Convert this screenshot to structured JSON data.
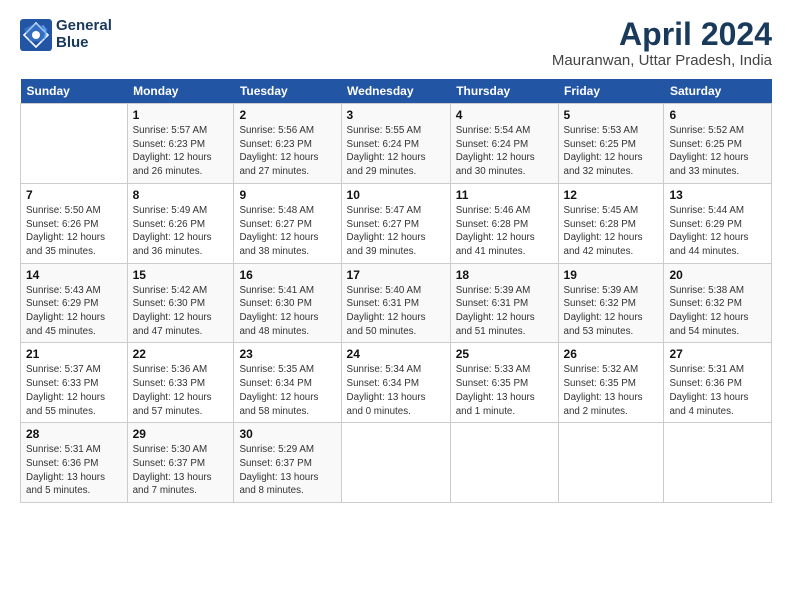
{
  "header": {
    "logo_line1": "General",
    "logo_line2": "Blue",
    "title": "April 2024",
    "subtitle": "Mauranwan, Uttar Pradesh, India"
  },
  "days_of_week": [
    "Sunday",
    "Monday",
    "Tuesday",
    "Wednesday",
    "Thursday",
    "Friday",
    "Saturday"
  ],
  "weeks": [
    [
      {
        "num": "",
        "info": ""
      },
      {
        "num": "1",
        "info": "Sunrise: 5:57 AM\nSunset: 6:23 PM\nDaylight: 12 hours\nand 26 minutes."
      },
      {
        "num": "2",
        "info": "Sunrise: 5:56 AM\nSunset: 6:23 PM\nDaylight: 12 hours\nand 27 minutes."
      },
      {
        "num": "3",
        "info": "Sunrise: 5:55 AM\nSunset: 6:24 PM\nDaylight: 12 hours\nand 29 minutes."
      },
      {
        "num": "4",
        "info": "Sunrise: 5:54 AM\nSunset: 6:24 PM\nDaylight: 12 hours\nand 30 minutes."
      },
      {
        "num": "5",
        "info": "Sunrise: 5:53 AM\nSunset: 6:25 PM\nDaylight: 12 hours\nand 32 minutes."
      },
      {
        "num": "6",
        "info": "Sunrise: 5:52 AM\nSunset: 6:25 PM\nDaylight: 12 hours\nand 33 minutes."
      }
    ],
    [
      {
        "num": "7",
        "info": "Sunrise: 5:50 AM\nSunset: 6:26 PM\nDaylight: 12 hours\nand 35 minutes."
      },
      {
        "num": "8",
        "info": "Sunrise: 5:49 AM\nSunset: 6:26 PM\nDaylight: 12 hours\nand 36 minutes."
      },
      {
        "num": "9",
        "info": "Sunrise: 5:48 AM\nSunset: 6:27 PM\nDaylight: 12 hours\nand 38 minutes."
      },
      {
        "num": "10",
        "info": "Sunrise: 5:47 AM\nSunset: 6:27 PM\nDaylight: 12 hours\nand 39 minutes."
      },
      {
        "num": "11",
        "info": "Sunrise: 5:46 AM\nSunset: 6:28 PM\nDaylight: 12 hours\nand 41 minutes."
      },
      {
        "num": "12",
        "info": "Sunrise: 5:45 AM\nSunset: 6:28 PM\nDaylight: 12 hours\nand 42 minutes."
      },
      {
        "num": "13",
        "info": "Sunrise: 5:44 AM\nSunset: 6:29 PM\nDaylight: 12 hours\nand 44 minutes."
      }
    ],
    [
      {
        "num": "14",
        "info": "Sunrise: 5:43 AM\nSunset: 6:29 PM\nDaylight: 12 hours\nand 45 minutes."
      },
      {
        "num": "15",
        "info": "Sunrise: 5:42 AM\nSunset: 6:30 PM\nDaylight: 12 hours\nand 47 minutes."
      },
      {
        "num": "16",
        "info": "Sunrise: 5:41 AM\nSunset: 6:30 PM\nDaylight: 12 hours\nand 48 minutes."
      },
      {
        "num": "17",
        "info": "Sunrise: 5:40 AM\nSunset: 6:31 PM\nDaylight: 12 hours\nand 50 minutes."
      },
      {
        "num": "18",
        "info": "Sunrise: 5:39 AM\nSunset: 6:31 PM\nDaylight: 12 hours\nand 51 minutes."
      },
      {
        "num": "19",
        "info": "Sunrise: 5:39 AM\nSunset: 6:32 PM\nDaylight: 12 hours\nand 53 minutes."
      },
      {
        "num": "20",
        "info": "Sunrise: 5:38 AM\nSunset: 6:32 PM\nDaylight: 12 hours\nand 54 minutes."
      }
    ],
    [
      {
        "num": "21",
        "info": "Sunrise: 5:37 AM\nSunset: 6:33 PM\nDaylight: 12 hours\nand 55 minutes."
      },
      {
        "num": "22",
        "info": "Sunrise: 5:36 AM\nSunset: 6:33 PM\nDaylight: 12 hours\nand 57 minutes."
      },
      {
        "num": "23",
        "info": "Sunrise: 5:35 AM\nSunset: 6:34 PM\nDaylight: 12 hours\nand 58 minutes."
      },
      {
        "num": "24",
        "info": "Sunrise: 5:34 AM\nSunset: 6:34 PM\nDaylight: 13 hours\nand 0 minutes."
      },
      {
        "num": "25",
        "info": "Sunrise: 5:33 AM\nSunset: 6:35 PM\nDaylight: 13 hours\nand 1 minute."
      },
      {
        "num": "26",
        "info": "Sunrise: 5:32 AM\nSunset: 6:35 PM\nDaylight: 13 hours\nand 2 minutes."
      },
      {
        "num": "27",
        "info": "Sunrise: 5:31 AM\nSunset: 6:36 PM\nDaylight: 13 hours\nand 4 minutes."
      }
    ],
    [
      {
        "num": "28",
        "info": "Sunrise: 5:31 AM\nSunset: 6:36 PM\nDaylight: 13 hours\nand 5 minutes."
      },
      {
        "num": "29",
        "info": "Sunrise: 5:30 AM\nSunset: 6:37 PM\nDaylight: 13 hours\nand 7 minutes."
      },
      {
        "num": "30",
        "info": "Sunrise: 5:29 AM\nSunset: 6:37 PM\nDaylight: 13 hours\nand 8 minutes."
      },
      {
        "num": "",
        "info": ""
      },
      {
        "num": "",
        "info": ""
      },
      {
        "num": "",
        "info": ""
      },
      {
        "num": "",
        "info": ""
      }
    ]
  ]
}
